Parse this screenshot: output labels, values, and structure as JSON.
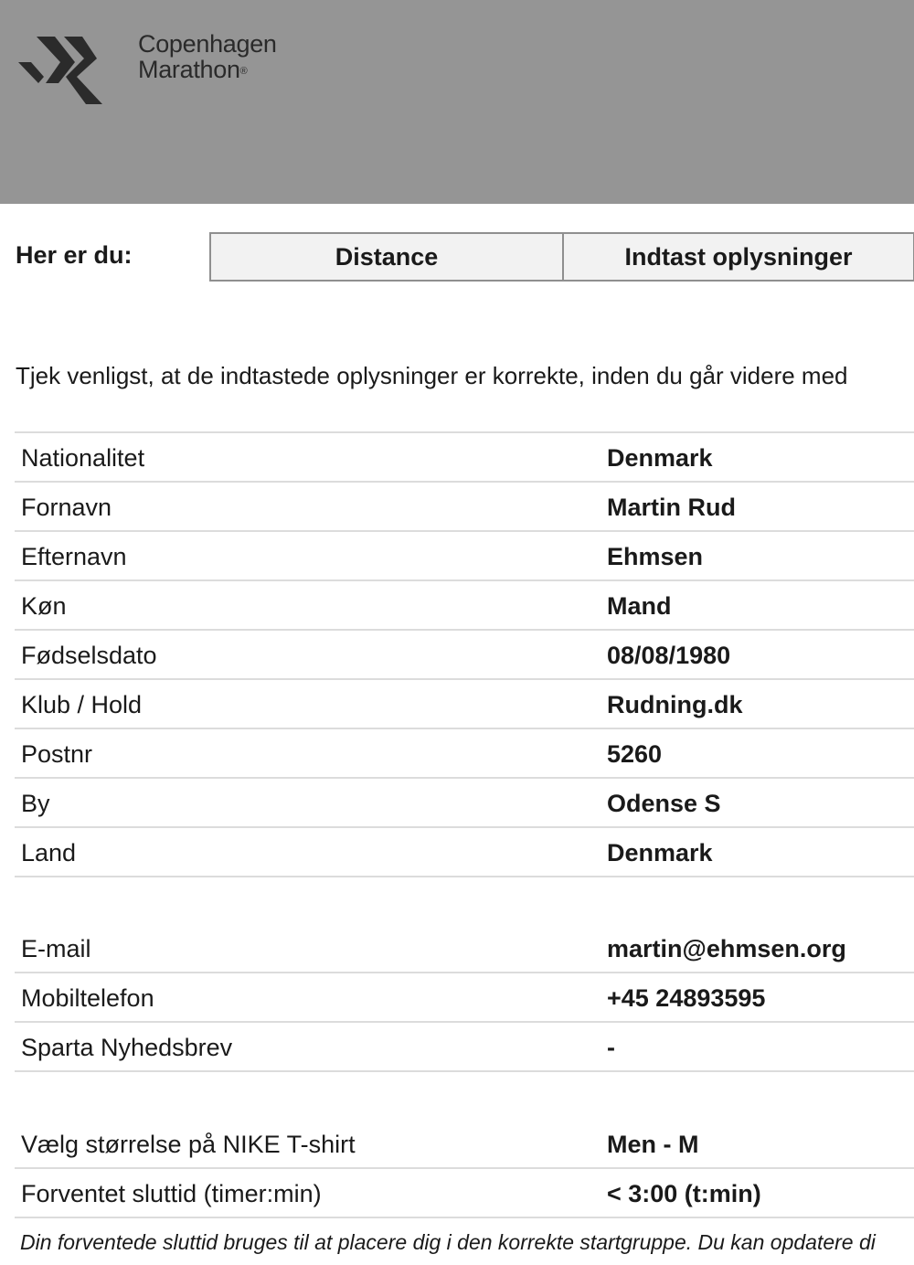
{
  "brand": {
    "line1": "Copenhagen",
    "line2": "Marathon",
    "registered": "®",
    "header_color": "#959595"
  },
  "progress": {
    "label": "Her er du:",
    "steps": [
      "Distance",
      "Indtast oplysninger"
    ]
  },
  "intro_text": "Tjek venligst, at de indtastede oplysninger er korrekte, inden du går videre med",
  "personal": [
    {
      "label": "Nationalitet",
      "value": "Denmark"
    },
    {
      "label": "Fornavn",
      "value": "Martin Rud"
    },
    {
      "label": "Efternavn",
      "value": "Ehmsen"
    },
    {
      "label": "Køn",
      "value": "Mand"
    },
    {
      "label": "Fødselsdato",
      "value": "08/08/1980"
    },
    {
      "label": "Klub / Hold",
      "value": "Rudning.dk"
    },
    {
      "label": "Postnr",
      "value": "5260"
    },
    {
      "label": "By",
      "value": "Odense S"
    },
    {
      "label": "Land",
      "value": "Denmark"
    }
  ],
  "contact": [
    {
      "label": "E-mail",
      "value": "martin@ehmsen.org"
    },
    {
      "label": "Mobiltelefon",
      "value": "+45 24893595"
    },
    {
      "label": "Sparta Nyhedsbrev",
      "value": "-"
    }
  ],
  "extras": [
    {
      "label": "Vælg størrelse på NIKE T-shirt",
      "value": "Men - M"
    },
    {
      "label": "Forventet sluttid (timer:min)",
      "value": "< 3:00 (t:min)"
    }
  ],
  "finish_note": "Din forventede sluttid bruges til at placere dig i den korrekte startgruppe. Du kan opdatere di"
}
